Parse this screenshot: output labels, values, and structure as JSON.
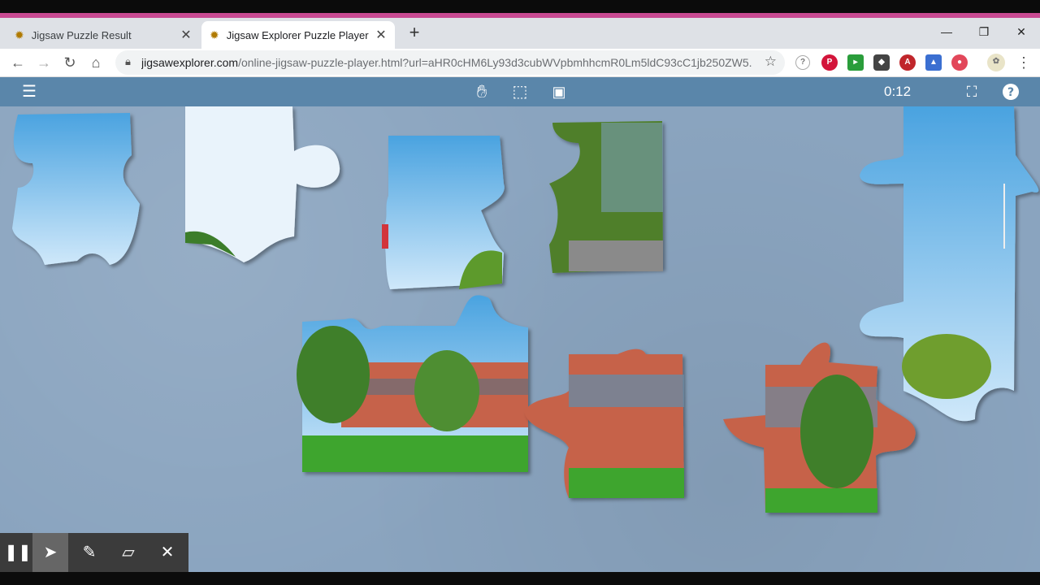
{
  "tabs": [
    {
      "title": "Jigsaw Puzzle Result",
      "active": false
    },
    {
      "title": "Jigsaw Explorer Puzzle Player",
      "active": true
    }
  ],
  "address": {
    "domain": "jigsawexplorer.com",
    "path": "/online-jigsaw-puzzle-player.html?url=aHR0cHM6Ly93d3cubWVpbmhhcmR0Lm5ldC93cC1jb250ZW5..."
  },
  "timer": "0:12",
  "colors": {
    "accent": "#c84a92",
    "app_bar": "#5a86aa",
    "board": "#8aa4bf",
    "sky": "#5fb0e6",
    "grass": "#3ea52e",
    "building": "#c6624a"
  },
  "icons": {
    "hand": "hand-icon",
    "select": "selection-icon",
    "image": "image-icon",
    "fullscreen": "fullscreen-icon",
    "help": "help-icon",
    "menu": "menu-icon"
  }
}
